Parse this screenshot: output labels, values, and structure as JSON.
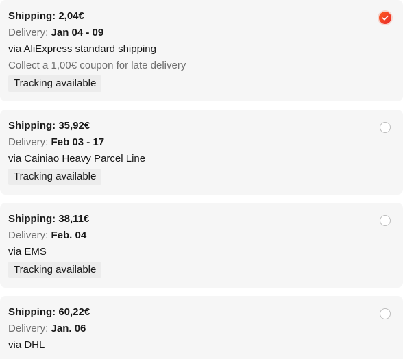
{
  "options": [
    {
      "shipping_label": "Shipping: 2,04€",
      "delivery_prefix": "Delivery: ",
      "delivery_date": "Jan 04 - 09",
      "via": "via AliExpress standard shipping",
      "coupon": "Collect a 1,00€ coupon for late delivery",
      "tracking": "Tracking available",
      "selected": true
    },
    {
      "shipping_label": "Shipping: 35,92€",
      "delivery_prefix": "Delivery: ",
      "delivery_date": "Feb 03 - 17",
      "via": "via Cainiao Heavy Parcel Line",
      "tracking": "Tracking available",
      "selected": false
    },
    {
      "shipping_label": "Shipping: 38,11€",
      "delivery_prefix": "Delivery: ",
      "delivery_date": "Feb. 04",
      "via": "via EMS",
      "tracking": "Tracking available",
      "selected": false
    },
    {
      "shipping_label": "Shipping: 60,22€",
      "delivery_prefix": "Delivery: ",
      "delivery_date": "Jan. 06",
      "via": "via DHL",
      "selected": false
    }
  ],
  "colors": {
    "card_background": "#f6f6f6",
    "badge_background": "#ececec",
    "selected_radio": "#ff4a22",
    "muted_text": "#6f6f6f"
  },
  "icons": {
    "selected_radio": "check-icon"
  }
}
